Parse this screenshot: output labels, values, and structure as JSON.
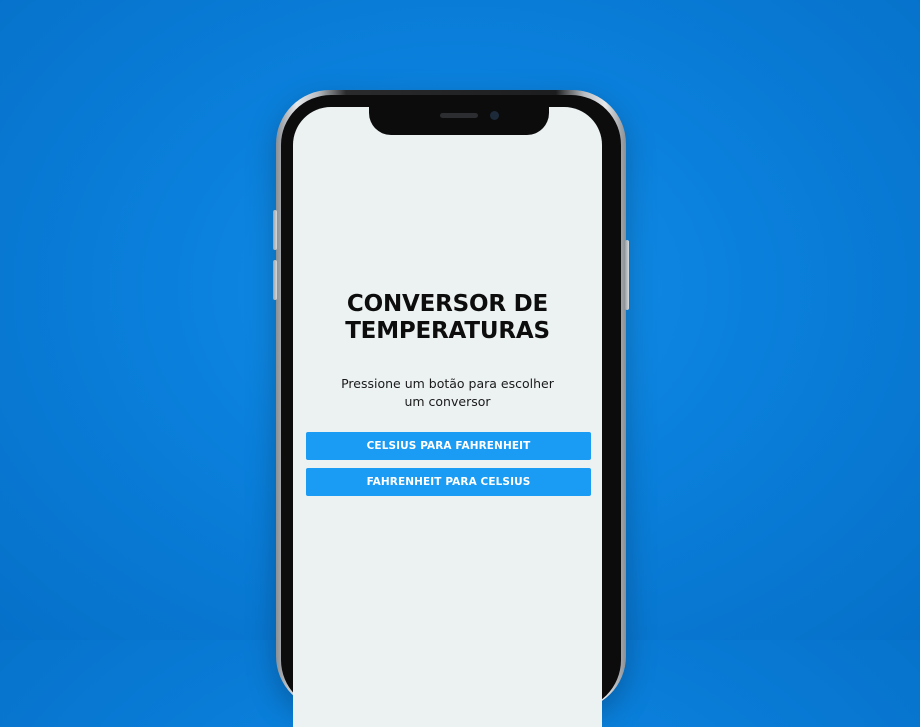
{
  "app": {
    "title": "CONVERSOR DE TEMPERATURAS",
    "subtitle": "Pressione um botão para escolher um conversor"
  },
  "buttons": {
    "celsius_to_fahrenheit": "CELSIUS PARA FAHRENHEIT",
    "fahrenheit_to_celsius": "FAHRENHEIT PARA CELSIUS"
  },
  "colors": {
    "background": "#0a80dc",
    "screen": "#ecf1f2",
    "button": "#1a9bf4",
    "button_text": "#ffffff",
    "title_text": "#0d0d0d"
  }
}
